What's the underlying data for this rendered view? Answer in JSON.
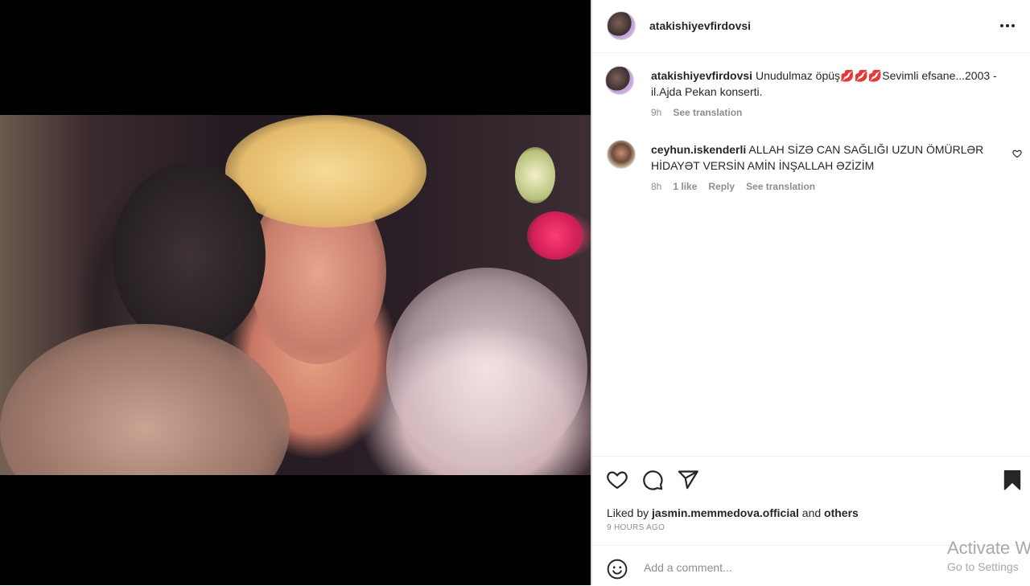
{
  "post": {
    "author": "atakishiyevfirdovsi",
    "caption": "Unudulmaz öpüş💋💋💋Sevimli efsane...2003 - il.Ajda Pekan konserti.",
    "caption_time": "9h",
    "see_translation": "See translation"
  },
  "comments": [
    {
      "user": "ceyhun.iskenderli",
      "text": "ALLAH SİZƏ CAN SAĞLIĞI UZUN ÖMÜRLƏR HİDAYƏT VERSİN AMİN İNŞALLAH ƏZİZİM",
      "time": "8h",
      "likes": "1 like",
      "reply": "Reply",
      "see_translation": "See translation"
    }
  ],
  "actions": {
    "like_icon": "heart-icon",
    "comment_icon": "comment-icon",
    "share_icon": "share-icon",
    "save_icon": "bookmark-icon"
  },
  "likes": {
    "prefix": "Liked by",
    "user": "jasmin.memmedova.official",
    "and": "and",
    "others": "others"
  },
  "time_ago": "9 HOURS AGO",
  "comment_input": {
    "placeholder": "Add a comment..."
  },
  "watermark": {
    "line1": "Activate W",
    "line2": "Go to Settings"
  }
}
